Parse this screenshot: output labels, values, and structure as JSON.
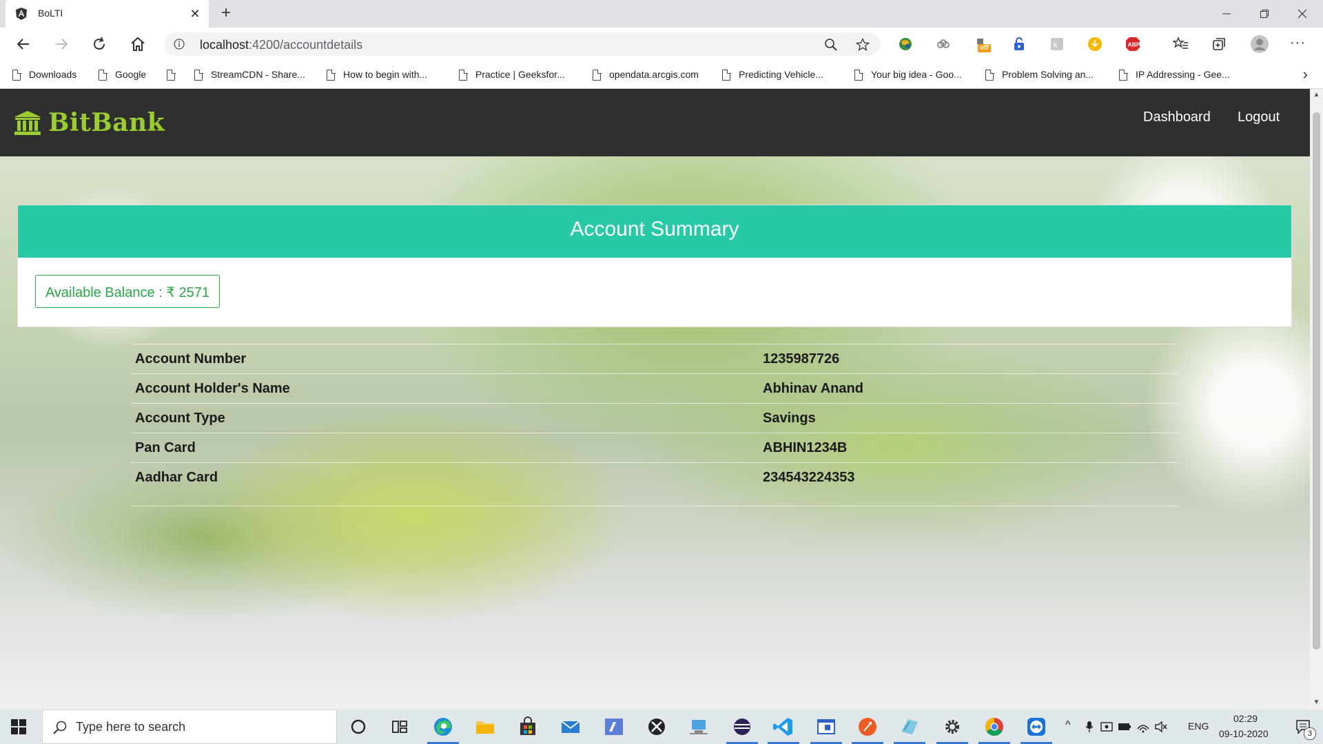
{
  "browser": {
    "tab_title": "BoLTI",
    "url_host": "localhost",
    "url_path": ":4200/accountdetails",
    "bookmarks": [
      "Downloads",
      "Google",
      "",
      "StreamCDN - Share...",
      "How to begin with...",
      "Practice | Geeksfor...",
      "opendata.arcgis.com",
      "Predicting Vehicle...",
      "Your big idea - Goo...",
      "Problem Solving an...",
      "IP Addressing - Gee..."
    ],
    "extensions": [
      "globe-ext-icon",
      "cloud-ext-icon",
      "deal-off-ext-icon",
      "lock-ext-icon",
      "translate-ext-icon",
      "download-ext-icon",
      "adblock-ext-icon"
    ],
    "ext_badge": "off"
  },
  "app": {
    "brand": "BitBank",
    "nav": {
      "dashboard": "Dashboard",
      "logout": "Logout"
    },
    "summary_title": "Account Summary",
    "balance_label": "Available Balance : ₹ 2571",
    "details": [
      {
        "label": "Account Number",
        "value": "1235987726"
      },
      {
        "label": "Account Holder's Name",
        "value": "Abhinav Anand"
      },
      {
        "label": "Account Type",
        "value": "Savings"
      },
      {
        "label": "Pan Card",
        "value": "ABHIN1234B"
      },
      {
        "label": "Aadhar Card",
        "value": "234543224353"
      }
    ]
  },
  "taskbar": {
    "search_placeholder": "Type here to search",
    "language": "ENG",
    "time": "02:29",
    "date": "09-10-2020",
    "notifications": "3"
  },
  "colors": {
    "navbar": "#2f2f2f",
    "brand": "#9acd32",
    "header_teal": "#27c9a6",
    "balance_green": "#28a745"
  }
}
